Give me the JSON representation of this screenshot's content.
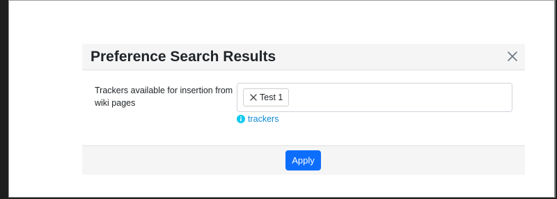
{
  "dialog": {
    "title": "Preference Search Results",
    "close_icon": "close-icon"
  },
  "preference": {
    "label": "Trackers available for insertion from wiki pages",
    "selected_tags": [
      {
        "label": "Test 1",
        "remove_icon": "x-icon"
      }
    ],
    "help": {
      "icon": "info-circle-icon",
      "link_text": "trackers"
    }
  },
  "footer": {
    "apply_label": "Apply"
  },
  "colors": {
    "primary": "#0d6efd",
    "link": "#0d8bd6",
    "header_bg": "#f5f5f5",
    "text": "#212529"
  }
}
